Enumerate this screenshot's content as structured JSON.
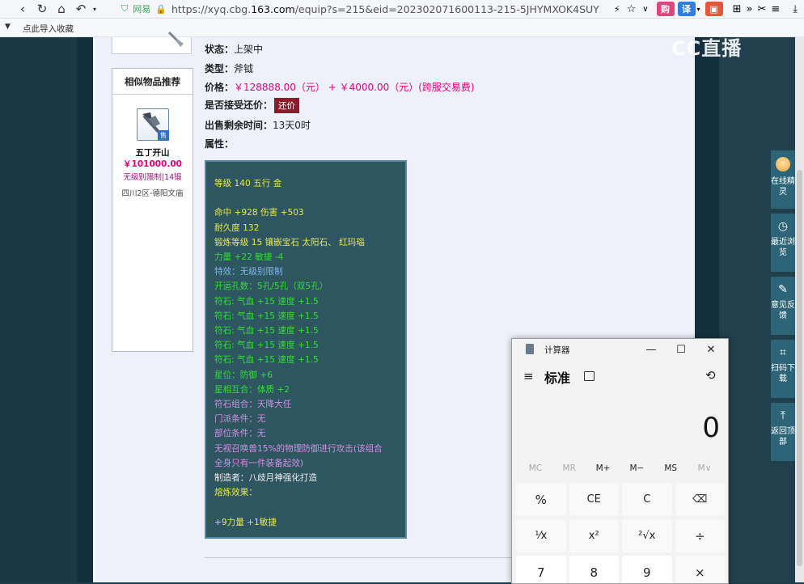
{
  "browser": {
    "nav": {
      "back": "‹",
      "refresh": "↻",
      "home": "⌂",
      "undo": "↶"
    },
    "secure_label": "网易",
    "url_prefix": "https://xyq.cbg.",
    "url_host": "163.com",
    "url_rest": "/equip?s=215&eid=202302071600113-215-5JHYMXOK4SUY",
    "bookmark_label": "点此导入收藏",
    "extensions": [
      {
        "label": "购",
        "color": "#e0457b"
      },
      {
        "label": "译",
        "color": "#2f7fe0"
      },
      {
        "label": "▣",
        "color": "#e9553a"
      }
    ]
  },
  "logo_text": "CC直播",
  "equip": {
    "status_label": "状态：",
    "status_value": "上架中",
    "type_label": "类型：",
    "type_value": "斧钺",
    "price_label": "价格：",
    "price_value": "￥128888.00（元） +  ￥4000.00（元）(跨服交易费)",
    "counter_label": "是否接受还价：",
    "counter_button": "还价",
    "time_label": "出售剩余时间：",
    "time_value": "13天0时",
    "attr_label": "属性："
  },
  "attributes": [
    {
      "text": "等级 140 五行 金",
      "color": "y"
    },
    {
      "text": "",
      "color": "w"
    },
    {
      "text": "命中 +928 伤害 +503",
      "color": "y"
    },
    {
      "text": "耐久度 132",
      "color": "y"
    },
    {
      "text": "锻炼等级 15 镶嵌宝石 太阳石、 红玛瑙",
      "color": "y"
    },
    {
      "text": "力量 +22 敏捷 -4",
      "color": "g"
    },
    {
      "text": "特效：无级别限制",
      "color": "b"
    },
    {
      "text": "开运孔数：5孔/5孔（双5孔）",
      "color": "g"
    },
    {
      "text": "符石: 气血 +15 速度 +1.5",
      "color": "g"
    },
    {
      "text": "符石: 气血 +15 速度 +1.5",
      "color": "g"
    },
    {
      "text": "符石: 气血 +15 速度 +1.5",
      "color": "g"
    },
    {
      "text": "符石: 气血 +15 速度 +1.5",
      "color": "g"
    },
    {
      "text": "符石: 气血 +15 速度 +1.5",
      "color": "g"
    },
    {
      "text": "星位：防御 +6",
      "color": "g"
    },
    {
      "text": "星相互合：体质 +2",
      "color": "g"
    },
    {
      "text": "符石组合：天降大任",
      "color": "p"
    },
    {
      "text": "门派条件：无",
      "color": "p"
    },
    {
      "text": "部位条件：无",
      "color": "p"
    },
    {
      "text": "无视召唤兽15%的物理防御进行攻击(该组合",
      "color": "p"
    },
    {
      "text": "全身只有一件装备起效)",
      "color": "p"
    },
    {
      "text": "制造者：八歧月神强化打造",
      "color": "w"
    },
    {
      "text": "熔炼效果：",
      "color": "y"
    },
    {
      "text": "",
      "color": "w"
    },
    {
      "text": "+9力量 +1敏捷",
      "color": "y"
    }
  ],
  "similar": {
    "title": "相似物品推荐",
    "item_name": "五丁开山",
    "item_price": "￥101000.00",
    "item_desc": "无级别限制|14锻",
    "item_server": "四川2区-德阳文庙",
    "badge": "售"
  },
  "sidebar": [
    {
      "icon": "avatar",
      "label": "在线精灵"
    },
    {
      "icon": "◷",
      "label": "最近浏览"
    },
    {
      "icon": "✎",
      "label": "意见反馈"
    },
    {
      "icon": "⌗",
      "label": "扫码下载"
    },
    {
      "icon": "⤒",
      "label": "返回顶部"
    }
  ],
  "calculator": {
    "title": "计算器",
    "mode": "标准",
    "display": "0",
    "memory": [
      {
        "label": "MC",
        "enabled": false
      },
      {
        "label": "MR",
        "enabled": false
      },
      {
        "label": "M+",
        "enabled": true
      },
      {
        "label": "M−",
        "enabled": true
      },
      {
        "label": "MS",
        "enabled": true
      },
      {
        "label": "M∨",
        "enabled": false
      }
    ],
    "keys": [
      {
        "label": "%",
        "kind": "op"
      },
      {
        "label": "CE",
        "kind": "fn"
      },
      {
        "label": "C",
        "kind": "fn"
      },
      {
        "label": "⌫",
        "kind": "fn"
      },
      {
        "label": "¹⁄x",
        "kind": "fn"
      },
      {
        "label": "x²",
        "kind": "fn"
      },
      {
        "label": "²√x",
        "kind": "fn"
      },
      {
        "label": "÷",
        "kind": "op"
      },
      {
        "label": "7",
        "kind": "num"
      },
      {
        "label": "8",
        "kind": "num"
      },
      {
        "label": "9",
        "kind": "num"
      },
      {
        "label": "×",
        "kind": "op"
      }
    ]
  }
}
